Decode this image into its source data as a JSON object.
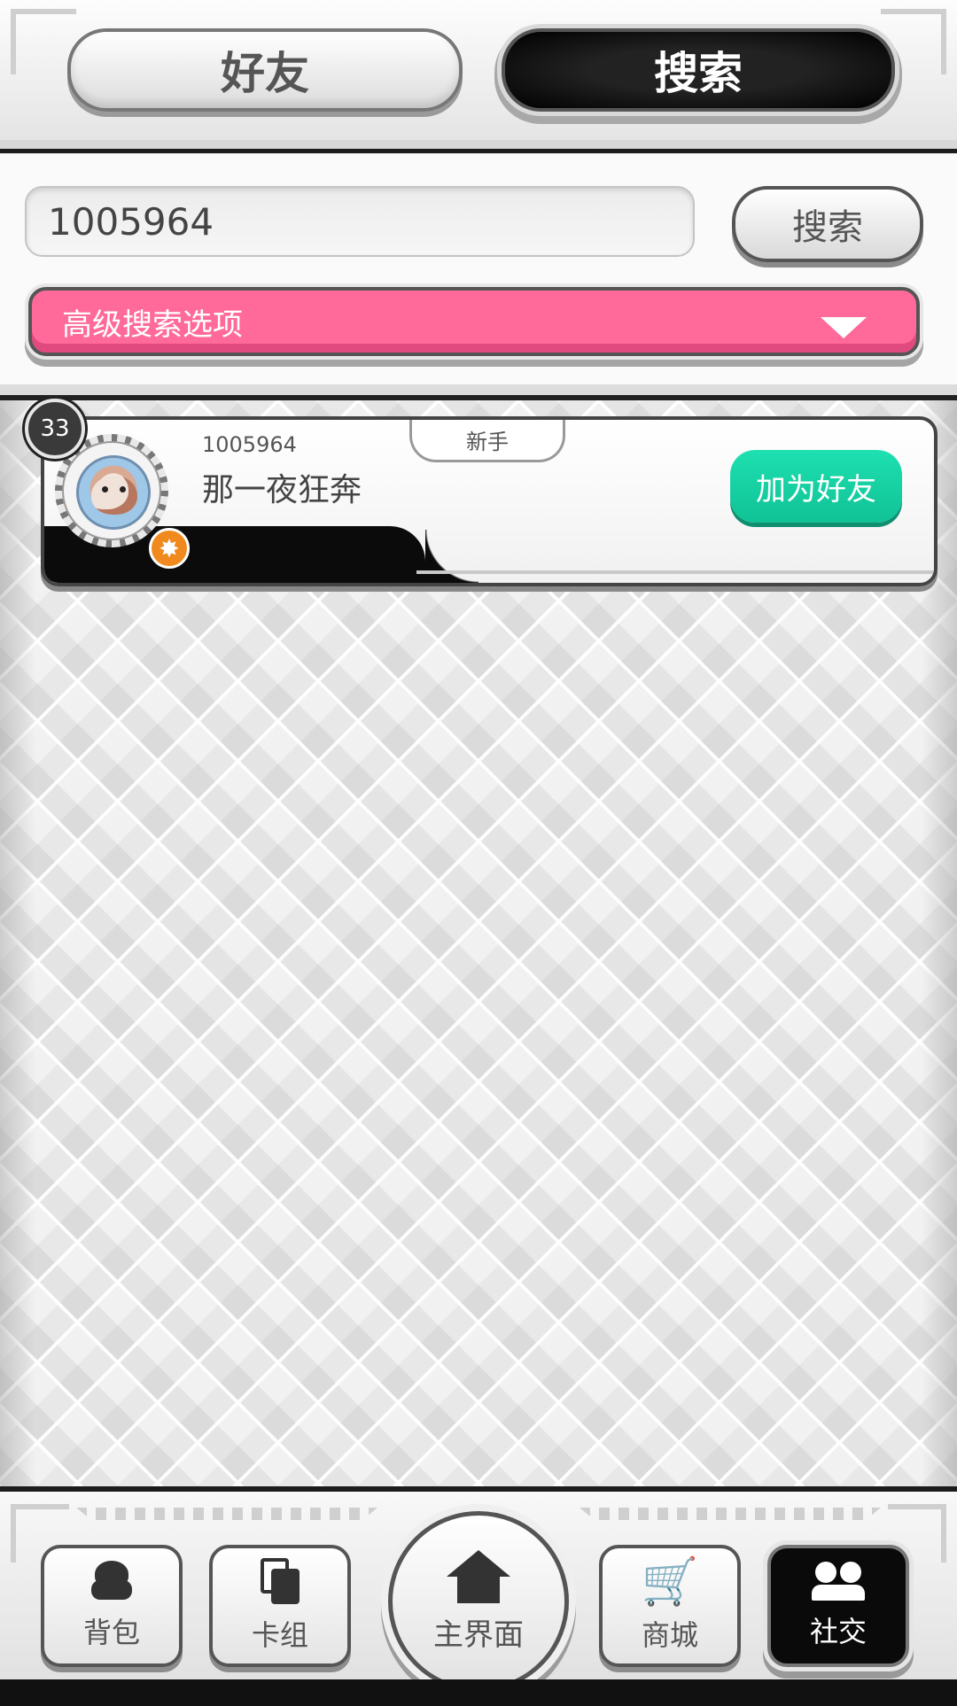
{
  "tabs": {
    "friends": "好友",
    "search": "搜索"
  },
  "search": {
    "input_value": "1005964",
    "button_label": "搜索",
    "advanced_label": "高级搜索选项"
  },
  "result": {
    "level": "33",
    "id": "1005964",
    "name": "那一夜狂奔",
    "rank": "新手",
    "add_button": "加为好友",
    "add_button_color": "#14cf9f"
  },
  "nav": {
    "bag": "背包",
    "cards": "卡组",
    "home": "主界面",
    "shop": "商城",
    "social": "社交",
    "active": "social"
  },
  "colors": {
    "accent_pink": "#ff6a9a",
    "badge_orange": "#f08a1e"
  }
}
